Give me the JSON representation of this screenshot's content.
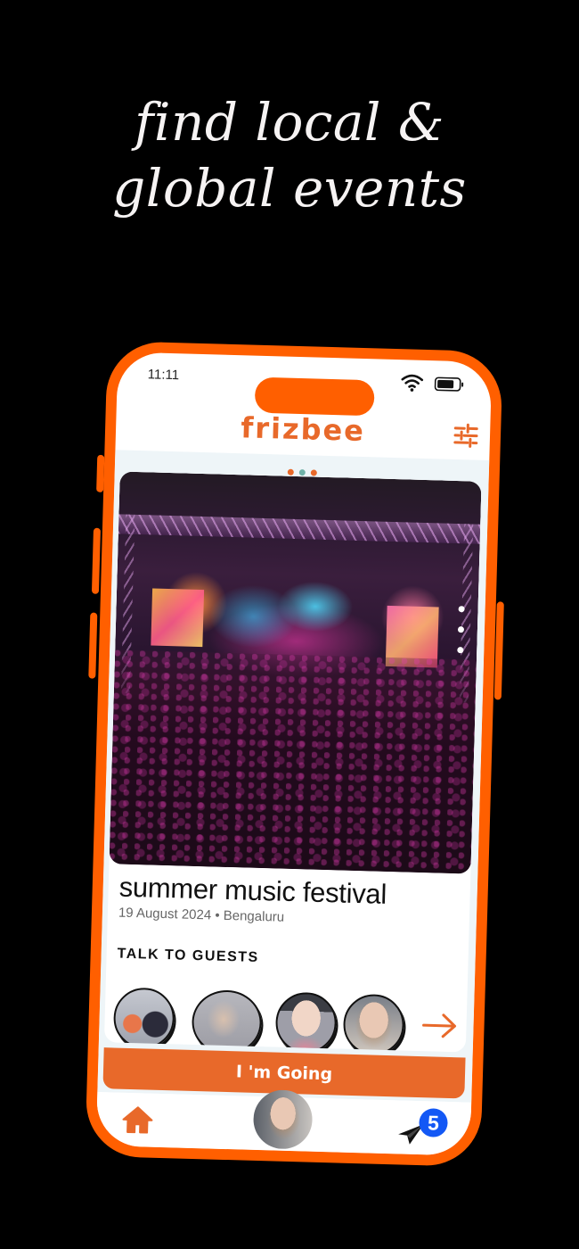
{
  "promo": {
    "headline_line1": "find local &",
    "headline_line2": "global events"
  },
  "status_bar": {
    "time": "11:11",
    "icons": [
      "wifi-icon",
      "battery-icon"
    ]
  },
  "header": {
    "logo": "frizbee",
    "filter_icon": "sliders-icon"
  },
  "colors": {
    "brand_orange": "#e8692a",
    "frame_orange": "#ff5f00",
    "badge_blue": "#1358f5",
    "active_dot": "#6fb1a8"
  },
  "carousel": {
    "pages": 3,
    "active_index": 1
  },
  "event": {
    "title": "summer music festival",
    "meta": "19 August 2024 • Bengaluru",
    "image_alt": "concert stage with crowd",
    "image_pages": 3
  },
  "guests": {
    "heading": "TALK TO GUESTS",
    "avatars": [
      "guest-1",
      "guest-2",
      "guest-3",
      "guest-4"
    ],
    "next_icon": "arrow-right-icon"
  },
  "cta": {
    "label": "I 'm Going"
  },
  "tab_bar": {
    "home_icon": "home-icon",
    "profile_icon": "profile-avatar",
    "messages_icon": "send-icon",
    "messages_badge": "5"
  }
}
